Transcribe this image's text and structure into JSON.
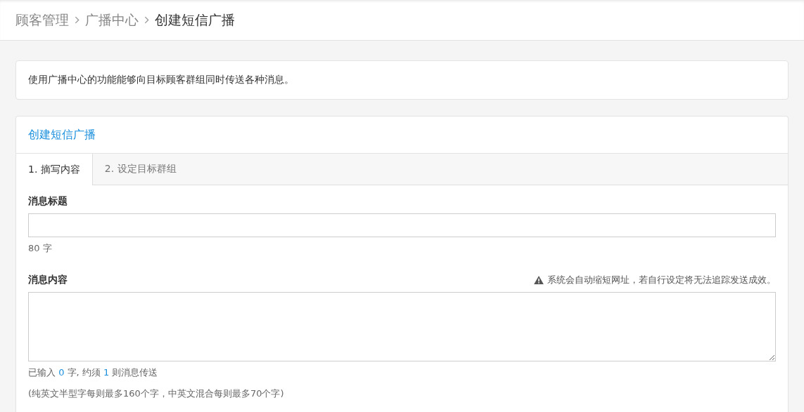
{
  "breadcrumb": [
    {
      "label": "顾客管理",
      "current": false
    },
    {
      "label": "广播中心",
      "current": false
    },
    {
      "label": "创建短信广播",
      "current": true
    }
  ],
  "notice": "使用广播中心的功能能够向目标顾客群组同时传送各种消息。",
  "panel": {
    "title": "创建短信广播",
    "tabs": [
      {
        "label": "1. 摘写内容",
        "selected": true
      },
      {
        "label": "2. 设定目标群组",
        "selected": false
      }
    ],
    "title_field": {
      "label": "消息标题",
      "hint": "80 字"
    },
    "content_field": {
      "label": "消息内容",
      "warning": "系统会自动缩短网址，若自行设定将无法追踪发送成效。",
      "counter": [
        {
          "text": "已输入 ",
          "kind": "plain"
        },
        {
          "text": "0",
          "kind": "count"
        },
        {
          "text": " 字, 约须 ",
          "kind": "plain"
        },
        {
          "text": "1",
          "kind": "count"
        },
        {
          "text": " 则消息传送",
          "kind": "plain"
        }
      ],
      "note": "(纯英文半型字每则最多160个字，中英文混合每则最多70个字)"
    }
  }
}
